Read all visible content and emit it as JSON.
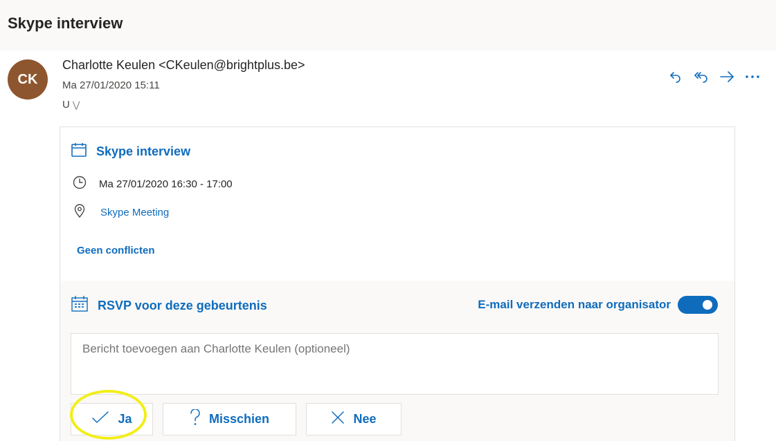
{
  "subject": "Skype interview",
  "sender": {
    "initials": "CK",
    "display": "Charlotte Keulen <CKeulen@brightplus.be>",
    "sent": "Ma 27/01/2020 15:11",
    "to": "U"
  },
  "icons": {
    "reply": "reply-icon",
    "reply_all": "reply-all-icon",
    "forward": "forward-icon",
    "more": "more-icon"
  },
  "event": {
    "title": "Skype interview",
    "time": "Ma 27/01/2020 16:30 - 17:00",
    "location": "Skype Meeting",
    "conflicts": "Geen conflicten"
  },
  "rsvp": {
    "heading": "RSVP voor deze gebeurtenis",
    "send_email_label": "E-mail verzenden naar organisator",
    "send_email_on": true,
    "message_placeholder": "Bericht toevoegen aan Charlotte Keulen (optioneel)",
    "buttons": {
      "yes": "Ja",
      "maybe": "Misschien",
      "no": "Nee"
    }
  },
  "colors": {
    "accent": "#0f6cbd",
    "avatar": "#8e562e",
    "highlight": "#f2ee1a"
  }
}
